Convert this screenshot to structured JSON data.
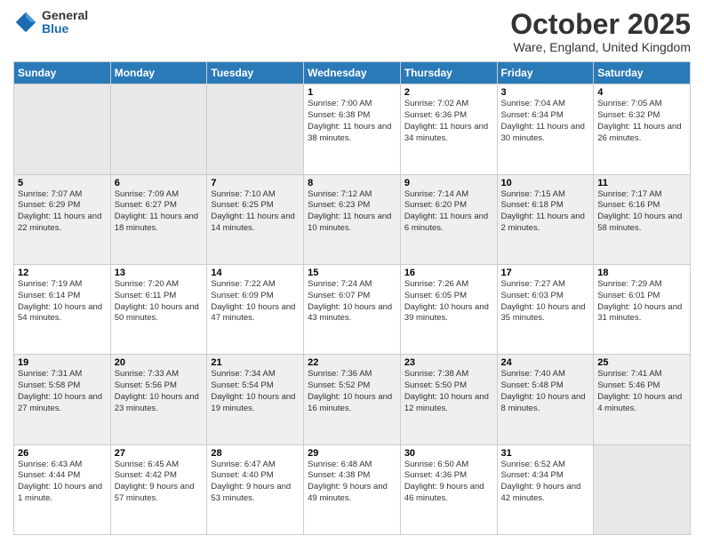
{
  "header": {
    "logo_general": "General",
    "logo_blue": "Blue",
    "month": "October 2025",
    "location": "Ware, England, United Kingdom"
  },
  "days_of_week": [
    "Sunday",
    "Monday",
    "Tuesday",
    "Wednesday",
    "Thursday",
    "Friday",
    "Saturday"
  ],
  "weeks": [
    [
      {
        "num": "",
        "sunrise": "",
        "sunset": "",
        "daylight": "",
        "empty": true
      },
      {
        "num": "",
        "sunrise": "",
        "sunset": "",
        "daylight": "",
        "empty": true
      },
      {
        "num": "",
        "sunrise": "",
        "sunset": "",
        "daylight": "",
        "empty": true
      },
      {
        "num": "1",
        "sunrise": "Sunrise: 7:00 AM",
        "sunset": "Sunset: 6:38 PM",
        "daylight": "Daylight: 11 hours and 38 minutes."
      },
      {
        "num": "2",
        "sunrise": "Sunrise: 7:02 AM",
        "sunset": "Sunset: 6:36 PM",
        "daylight": "Daylight: 11 hours and 34 minutes."
      },
      {
        "num": "3",
        "sunrise": "Sunrise: 7:04 AM",
        "sunset": "Sunset: 6:34 PM",
        "daylight": "Daylight: 11 hours and 30 minutes."
      },
      {
        "num": "4",
        "sunrise": "Sunrise: 7:05 AM",
        "sunset": "Sunset: 6:32 PM",
        "daylight": "Daylight: 11 hours and 26 minutes."
      }
    ],
    [
      {
        "num": "5",
        "sunrise": "Sunrise: 7:07 AM",
        "sunset": "Sunset: 6:29 PM",
        "daylight": "Daylight: 11 hours and 22 minutes."
      },
      {
        "num": "6",
        "sunrise": "Sunrise: 7:09 AM",
        "sunset": "Sunset: 6:27 PM",
        "daylight": "Daylight: 11 hours and 18 minutes."
      },
      {
        "num": "7",
        "sunrise": "Sunrise: 7:10 AM",
        "sunset": "Sunset: 6:25 PM",
        "daylight": "Daylight: 11 hours and 14 minutes."
      },
      {
        "num": "8",
        "sunrise": "Sunrise: 7:12 AM",
        "sunset": "Sunset: 6:23 PM",
        "daylight": "Daylight: 11 hours and 10 minutes."
      },
      {
        "num": "9",
        "sunrise": "Sunrise: 7:14 AM",
        "sunset": "Sunset: 6:20 PM",
        "daylight": "Daylight: 11 hours and 6 minutes."
      },
      {
        "num": "10",
        "sunrise": "Sunrise: 7:15 AM",
        "sunset": "Sunset: 6:18 PM",
        "daylight": "Daylight: 11 hours and 2 minutes."
      },
      {
        "num": "11",
        "sunrise": "Sunrise: 7:17 AM",
        "sunset": "Sunset: 6:16 PM",
        "daylight": "Daylight: 10 hours and 58 minutes."
      }
    ],
    [
      {
        "num": "12",
        "sunrise": "Sunrise: 7:19 AM",
        "sunset": "Sunset: 6:14 PM",
        "daylight": "Daylight: 10 hours and 54 minutes."
      },
      {
        "num": "13",
        "sunrise": "Sunrise: 7:20 AM",
        "sunset": "Sunset: 6:11 PM",
        "daylight": "Daylight: 10 hours and 50 minutes."
      },
      {
        "num": "14",
        "sunrise": "Sunrise: 7:22 AM",
        "sunset": "Sunset: 6:09 PM",
        "daylight": "Daylight: 10 hours and 47 minutes."
      },
      {
        "num": "15",
        "sunrise": "Sunrise: 7:24 AM",
        "sunset": "Sunset: 6:07 PM",
        "daylight": "Daylight: 10 hours and 43 minutes."
      },
      {
        "num": "16",
        "sunrise": "Sunrise: 7:26 AM",
        "sunset": "Sunset: 6:05 PM",
        "daylight": "Daylight: 10 hours and 39 minutes."
      },
      {
        "num": "17",
        "sunrise": "Sunrise: 7:27 AM",
        "sunset": "Sunset: 6:03 PM",
        "daylight": "Daylight: 10 hours and 35 minutes."
      },
      {
        "num": "18",
        "sunrise": "Sunrise: 7:29 AM",
        "sunset": "Sunset: 6:01 PM",
        "daylight": "Daylight: 10 hours and 31 minutes."
      }
    ],
    [
      {
        "num": "19",
        "sunrise": "Sunrise: 7:31 AM",
        "sunset": "Sunset: 5:58 PM",
        "daylight": "Daylight: 10 hours and 27 minutes."
      },
      {
        "num": "20",
        "sunrise": "Sunrise: 7:33 AM",
        "sunset": "Sunset: 5:56 PM",
        "daylight": "Daylight: 10 hours and 23 minutes."
      },
      {
        "num": "21",
        "sunrise": "Sunrise: 7:34 AM",
        "sunset": "Sunset: 5:54 PM",
        "daylight": "Daylight: 10 hours and 19 minutes."
      },
      {
        "num": "22",
        "sunrise": "Sunrise: 7:36 AM",
        "sunset": "Sunset: 5:52 PM",
        "daylight": "Daylight: 10 hours and 16 minutes."
      },
      {
        "num": "23",
        "sunrise": "Sunrise: 7:38 AM",
        "sunset": "Sunset: 5:50 PM",
        "daylight": "Daylight: 10 hours and 12 minutes."
      },
      {
        "num": "24",
        "sunrise": "Sunrise: 7:40 AM",
        "sunset": "Sunset: 5:48 PM",
        "daylight": "Daylight: 10 hours and 8 minutes."
      },
      {
        "num": "25",
        "sunrise": "Sunrise: 7:41 AM",
        "sunset": "Sunset: 5:46 PM",
        "daylight": "Daylight: 10 hours and 4 minutes."
      }
    ],
    [
      {
        "num": "26",
        "sunrise": "Sunrise: 6:43 AM",
        "sunset": "Sunset: 4:44 PM",
        "daylight": "Daylight: 10 hours and 1 minute."
      },
      {
        "num": "27",
        "sunrise": "Sunrise: 6:45 AM",
        "sunset": "Sunset: 4:42 PM",
        "daylight": "Daylight: 9 hours and 57 minutes."
      },
      {
        "num": "28",
        "sunrise": "Sunrise: 6:47 AM",
        "sunset": "Sunset: 4:40 PM",
        "daylight": "Daylight: 9 hours and 53 minutes."
      },
      {
        "num": "29",
        "sunrise": "Sunrise: 6:48 AM",
        "sunset": "Sunset: 4:38 PM",
        "daylight": "Daylight: 9 hours and 49 minutes."
      },
      {
        "num": "30",
        "sunrise": "Sunrise: 6:50 AM",
        "sunset": "Sunset: 4:36 PM",
        "daylight": "Daylight: 9 hours and 46 minutes."
      },
      {
        "num": "31",
        "sunrise": "Sunrise: 6:52 AM",
        "sunset": "Sunset: 4:34 PM",
        "daylight": "Daylight: 9 hours and 42 minutes."
      },
      {
        "num": "",
        "sunrise": "",
        "sunset": "",
        "daylight": "",
        "empty": true
      }
    ]
  ]
}
